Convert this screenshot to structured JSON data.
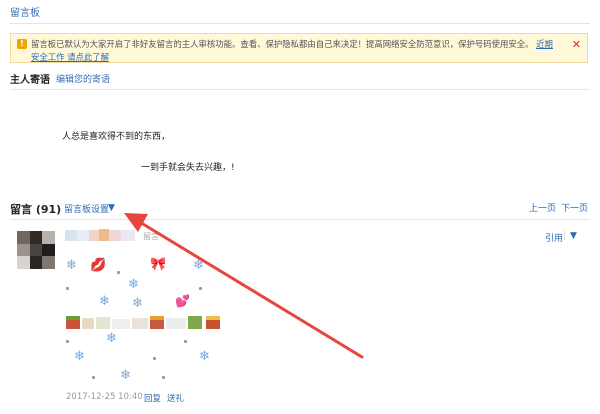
{
  "page": {
    "title": "留言板"
  },
  "notice": {
    "icon": "!",
    "text": "留言板已默认为大家开启了非好友留言的主人审核功能。查看、保护隐私都由自己来决定！提高网络安全防范意识，保护号码使用安全。",
    "link": "近期安全工作 请点此了解",
    "close": "✕"
  },
  "host": {
    "title": "主人寄语",
    "edit_label": "编辑您的寄语",
    "line1": "人总是喜欢得不到的东西，",
    "line2": "一到手就会失去兴趣，!"
  },
  "messages": {
    "title": "留言 (91)",
    "settings_label": "留言板设置",
    "settings_arrow": "▼",
    "prev": "上一页",
    "next": "下一页"
  },
  "entry": {
    "quote_label": "引用",
    "quote_sep": "|",
    "quote_menu": "▼",
    "name_suffix": "留言",
    "time": "2017-12-25 10:40",
    "reply": "回复",
    "gift": "送礼"
  },
  "colors": {
    "link": "#2a6bb5",
    "notice_bg": "#fff8d9",
    "arrow": "#e8453c"
  }
}
